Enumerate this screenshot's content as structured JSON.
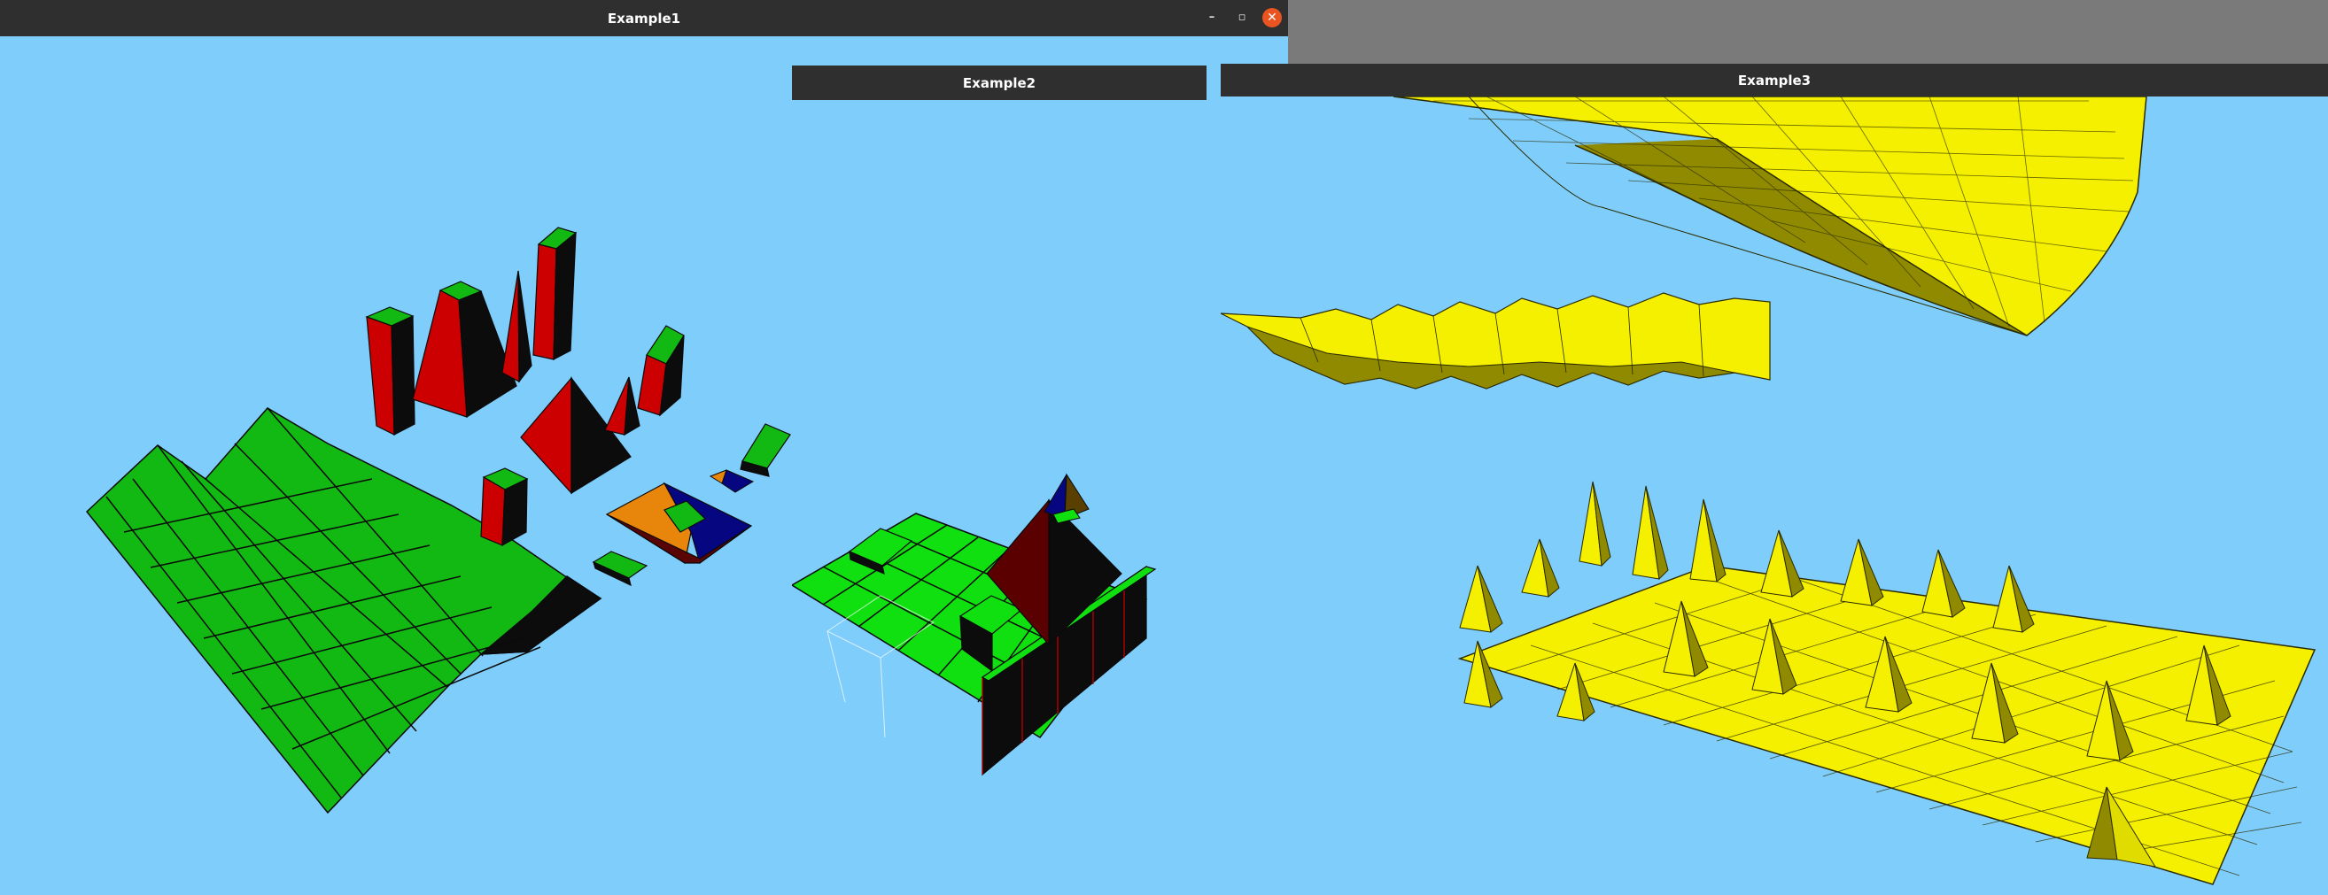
{
  "windows": [
    {
      "title": "Example1",
      "controls": {
        "minimize": "–",
        "maximize": "▫",
        "close": "✕"
      },
      "scene": "terrain-and-primitives"
    },
    {
      "title": "Example2",
      "scene": "grid-with-pyramid"
    },
    {
      "title": "Example3",
      "scene": "surfaces"
    }
  ],
  "colors": {
    "desktop": "#7a7a7a",
    "titlebar": "#2f2f2f",
    "titlebar_text": "#ffffff",
    "viewport_bg": "#7fcdfa",
    "close_button": "#e95420",
    "primitive_green": "#13b913",
    "primitive_red": "#cc0000",
    "primitive_dark": "#0c0c0c",
    "primitive_orange": "#e8860c",
    "primitive_blue": "#060680",
    "grid_green": "#10e010",
    "surface_yellow": "#f5f000",
    "surface_shadow": "#8f8a00"
  }
}
